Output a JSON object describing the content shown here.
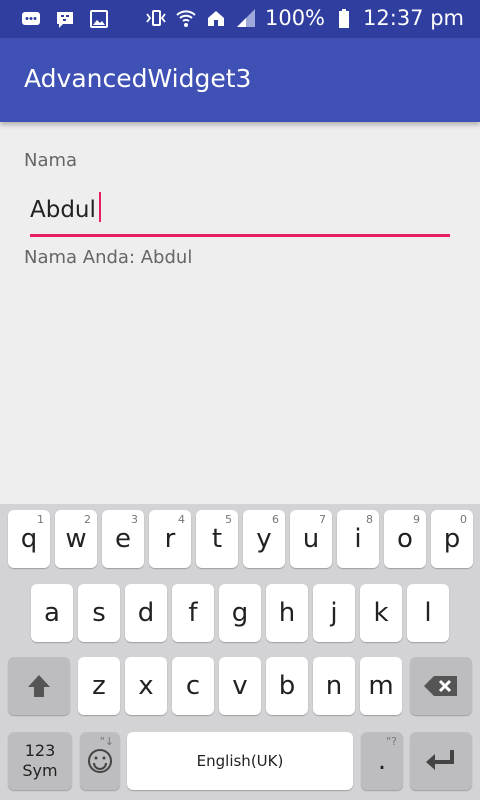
{
  "status_bar": {
    "battery": "100%",
    "time": "12:37 pm",
    "icons": [
      "chat-icon",
      "bbm-icon",
      "image-icon",
      "vibrate-icon",
      "wifi-icon",
      "home-icon",
      "signal-icon",
      "battery-icon"
    ]
  },
  "app": {
    "title": "AdvancedWidget3"
  },
  "form": {
    "label": "Nama",
    "value": "Abdul",
    "result": "Nama Anda: Abdul"
  },
  "keyboard": {
    "row1": [
      {
        "k": "q",
        "h": "1"
      },
      {
        "k": "w",
        "h": "2"
      },
      {
        "k": "e",
        "h": "3"
      },
      {
        "k": "r",
        "h": "4"
      },
      {
        "k": "t",
        "h": "5"
      },
      {
        "k": "y",
        "h": "6"
      },
      {
        "k": "u",
        "h": "7"
      },
      {
        "k": "i",
        "h": "8"
      },
      {
        "k": "o",
        "h": "9"
      },
      {
        "k": "p",
        "h": "0"
      }
    ],
    "row2": [
      "a",
      "s",
      "d",
      "f",
      "g",
      "h",
      "j",
      "k",
      "l"
    ],
    "row3": [
      "z",
      "x",
      "c",
      "v",
      "b",
      "n",
      "m"
    ],
    "sym": "123\nSym",
    "space": "English(UK)",
    "period": ".",
    "period_hint": "\"?",
    "emoji_hint": "\"↓"
  },
  "colors": {
    "statusbar": "#303f9f",
    "appbar": "#3f51b5",
    "accent": "#e91e63"
  }
}
